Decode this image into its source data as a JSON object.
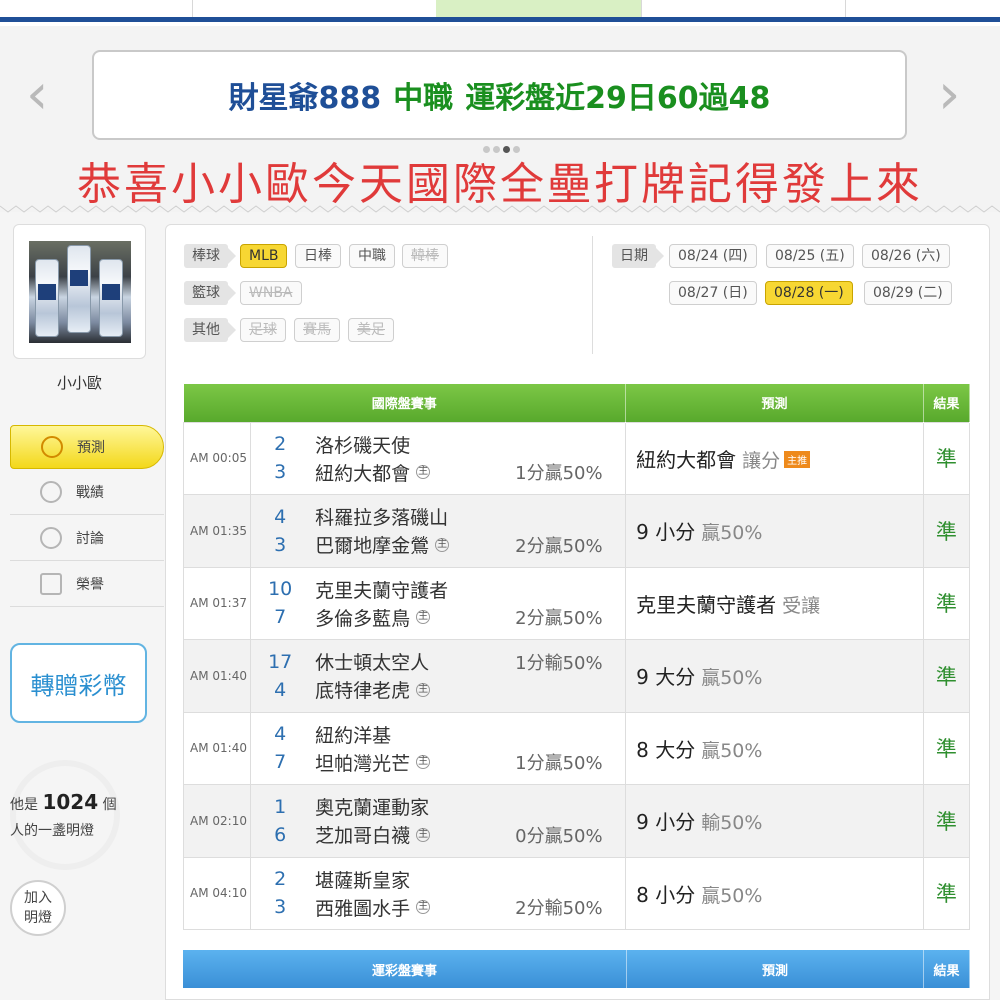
{
  "banner": {
    "name": "財星爺888",
    "league": "中職",
    "record": "運彩盤近29日60過48",
    "congrats": "恭喜小小歐今天國際全壘打牌記得發上來",
    "prev_arrow": "‹",
    "next_arrow": "›"
  },
  "profile": {
    "name": "小小歐"
  },
  "side_menu": [
    {
      "label": "預測",
      "icon": "target-icon",
      "active": true
    },
    {
      "label": "戰績",
      "icon": "search-record-icon"
    },
    {
      "label": "討論",
      "icon": "edit-icon"
    },
    {
      "label": "榮譽",
      "icon": "medal-icon"
    }
  ],
  "gift_button": "轉贈彩幣",
  "lamp": {
    "prefix": "他是",
    "count": "1024",
    "suffix": "個",
    "line2": "人的一盞明燈",
    "join_line1": "加入",
    "join_line2": "明燈"
  },
  "filters": {
    "baseball_label": "棒球",
    "baseball": [
      "MLB",
      "日棒",
      "中職",
      "韓棒"
    ],
    "basketball_label": "籃球",
    "basketball": [
      "WNBA"
    ],
    "other_label": "其他",
    "other": [
      "足球",
      "賽馬",
      "美足"
    ],
    "date_label": "日期",
    "dates_row1": [
      "08/24 (四)",
      "08/25 (五)",
      "08/26 (六)"
    ],
    "dates_row2": [
      "08/27 (日)",
      "08/28 (一)",
      "08/29 (二)"
    ]
  },
  "intl_table": {
    "headers": [
      "國際盤賽事",
      "預測",
      "結果"
    ],
    "rows": [
      {
        "time": "AM 00:05",
        "n1": "2",
        "t1": "洛杉磯天使",
        "n2": "3",
        "t2": "紐約大都會",
        "home": "主",
        "odds": "1分贏50%",
        "odds_line": 2,
        "pred": "紐約大都會",
        "pred_sub": "讓分",
        "pred_tag": "主推",
        "result": "準"
      },
      {
        "time": "AM 01:35",
        "n1": "4",
        "t1": "科羅拉多落磯山",
        "n2": "3",
        "t2": "巴爾地摩金鶯",
        "home": "主",
        "odds": "2分贏50%",
        "odds_line": 2,
        "pred": "9 小分",
        "pred_sub": "贏50%",
        "pred_tag": "",
        "result": "準"
      },
      {
        "time": "AM 01:37",
        "n1": "10",
        "t1": "克里夫蘭守護者",
        "n2": "7",
        "t2": "多倫多藍鳥",
        "home": "主",
        "odds": "2分贏50%",
        "odds_line": 2,
        "pred": "克里夫蘭守護者",
        "pred_sub": "受讓",
        "pred_tag": "",
        "result": "準"
      },
      {
        "time": "AM 01:40",
        "n1": "17",
        "t1": "休士頓太空人",
        "n2": "4",
        "t2": "底特律老虎",
        "home": "主",
        "odds": "1分輸50%",
        "odds_line": 1,
        "pred": "9 大分",
        "pred_sub": "贏50%",
        "pred_tag": "",
        "result": "準"
      },
      {
        "time": "AM 01:40",
        "n1": "4",
        "t1": "紐約洋基",
        "n2": "7",
        "t2": "坦帕灣光芒",
        "home": "主",
        "odds": "1分贏50%",
        "odds_line": 2,
        "pred": "8 大分",
        "pred_sub": "贏50%",
        "pred_tag": "",
        "result": "準"
      },
      {
        "time": "AM 02:10",
        "n1": "1",
        "t1": "奧克蘭運動家",
        "n2": "6",
        "t2": "芝加哥白襪",
        "home": "主",
        "odds": "0分贏50%",
        "odds_line": 2,
        "pred": "9 小分",
        "pred_sub": "輸50%",
        "pred_tag": "",
        "result": "準"
      },
      {
        "time": "AM 04:10",
        "n1": "2",
        "t1": "堪薩斯皇家",
        "n2": "3",
        "t2": "西雅圖水手",
        "home": "主",
        "odds": "2分輸50%",
        "odds_line": 2,
        "pred": "8 小分",
        "pred_sub": "贏50%",
        "pred_tag": "",
        "result": "準"
      }
    ]
  },
  "sports_table": {
    "headers": [
      "運彩盤賽事",
      "預測",
      "結果"
    ]
  },
  "colors": {
    "green_header": "#58a92c",
    "blue_header": "#3a8fd6",
    "accent_yellow": "#f7d733",
    "congrats_red": "#e03a3a",
    "brand_blue": "#1f4f97"
  }
}
